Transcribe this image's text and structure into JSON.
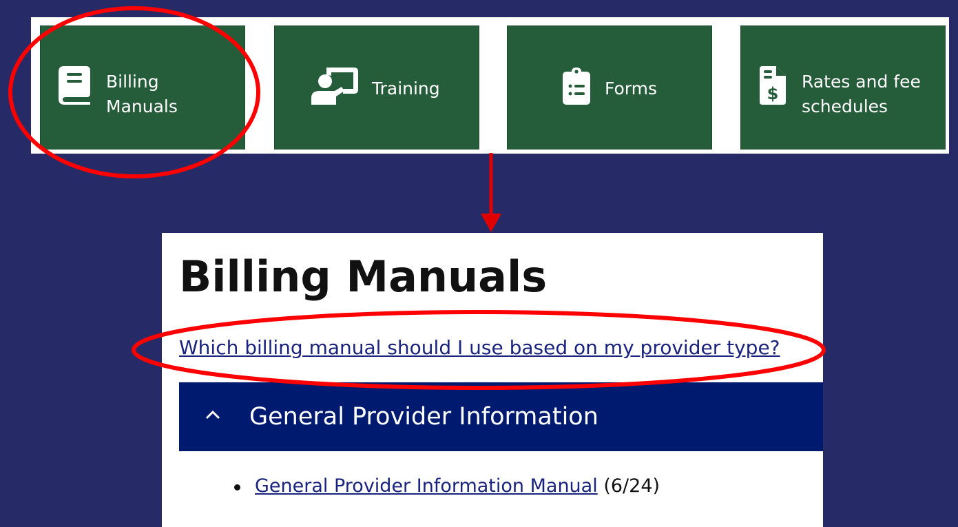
{
  "tiles": [
    {
      "label": "Billing Manuals",
      "icon": "book-icon"
    },
    {
      "label": "Training",
      "icon": "presentation-icon"
    },
    {
      "label": "Forms",
      "icon": "clipboard-list-icon"
    },
    {
      "label": "Rates and fee schedules",
      "icon": "invoice-dollar-icon"
    }
  ],
  "page": {
    "title": "Billing Manuals",
    "faq_link": "Which billing manual should I use based on my provider type?",
    "accordion": {
      "title": "General Provider Information",
      "expanded": true,
      "items": [
        {
          "link": "General Provider Information Manual",
          "date": "(6/24)"
        }
      ]
    }
  },
  "colors": {
    "background": "#262a66",
    "tile_green": "#255c39",
    "accordion_navy": "#001a70",
    "link_blue": "#1a237e",
    "annotation_red": "#ff0000"
  }
}
